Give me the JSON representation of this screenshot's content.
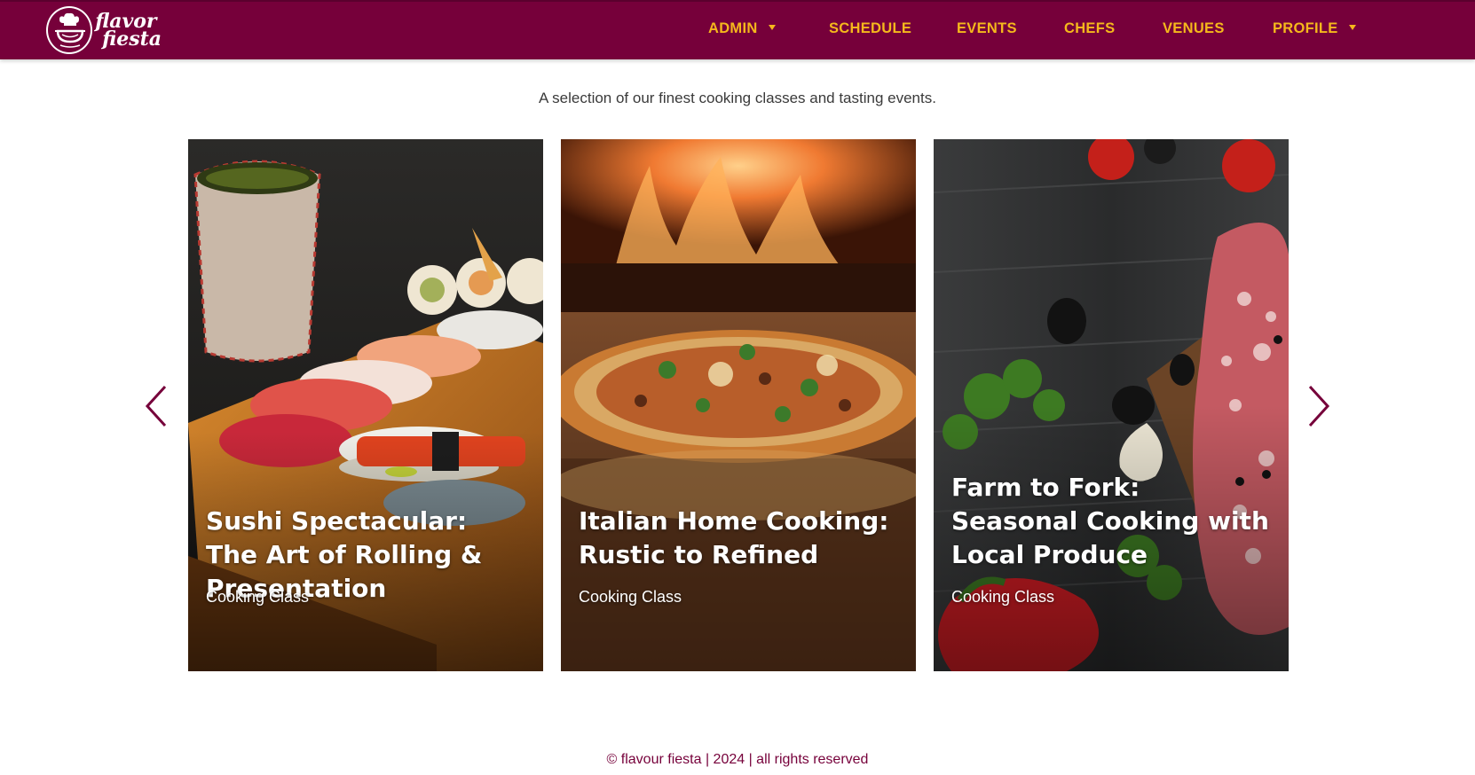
{
  "brand": {
    "logo_line1": "flavor",
    "logo_line2": "fiesta",
    "primary_color": "#76003a",
    "nav_text_color": "#f5b81c"
  },
  "nav": {
    "items": [
      {
        "label": "ADMIN",
        "dropdown": true
      },
      {
        "label": "SCHEDULE",
        "dropdown": false
      },
      {
        "label": "EVENTS",
        "dropdown": false
      },
      {
        "label": "CHEFS",
        "dropdown": false
      },
      {
        "label": "VENUES",
        "dropdown": false
      },
      {
        "label": "PROFILE",
        "dropdown": true
      }
    ]
  },
  "main": {
    "subtitle": "A selection of our finest cooking classes and tasting events.",
    "carousel": {
      "prev_icon": "chevron-left-icon",
      "next_icon": "chevron-right-icon",
      "cards": [
        {
          "title": "Sushi Spectacular: The Art of Rolling & Presentation",
          "type": "Cooking Class",
          "image": "sushi-platter-photo"
        },
        {
          "title": "Italian Home Cooking: Rustic to Refined",
          "type": "Cooking Class",
          "image": "wood-fired-pizza-photo"
        },
        {
          "title": "Farm to Fork: Seasonal Cooking with Local Produce",
          "type": "Cooking Class",
          "image": "raw-steak-vegetables-photo"
        }
      ]
    }
  },
  "footer": {
    "text": "© flavour fiesta | 2024 | all rights reserved"
  }
}
